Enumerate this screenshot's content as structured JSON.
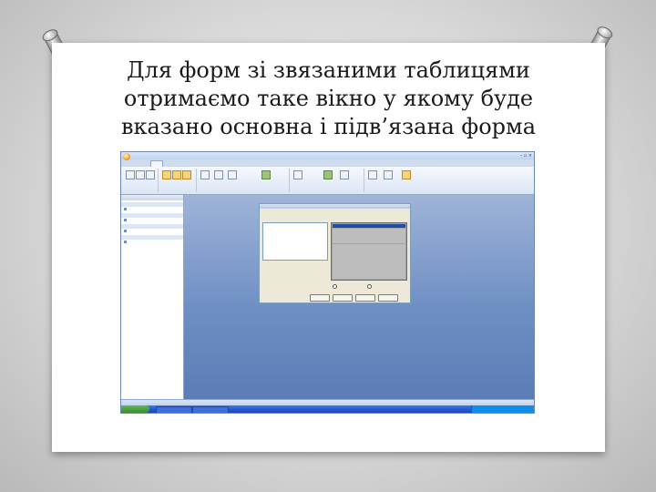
{
  "slide": {
    "title_lines": [
      "Для форм зі звязаними таблицями",
      "отримаємо таке вікно у якому буде",
      "вказано основна і підв’язана форма"
    ]
  },
  "screenshot": {
    "window_caption": "",
    "tabs": [
      "",
      "",
      "",
      ""
    ],
    "ribbon_groups": [
      "",
      "",
      "",
      ""
    ],
    "nav": {
      "header": "",
      "sections": [
        {
          "label": "",
          "items": [
            ""
          ]
        },
        {
          "label": "",
          "items": [
            ""
          ]
        },
        {
          "label": "",
          "items": [
            ""
          ]
        },
        {
          "label": "",
          "items": [
            ""
          ]
        }
      ]
    },
    "dialog": {
      "title": "",
      "question": "",
      "options": [
        "",
        ""
      ],
      "radio_1": "",
      "radio_2": "",
      "buttons": [
        "",
        "",
        "",
        ""
      ]
    },
    "status_left": "",
    "status_right": "",
    "taskbar": {
      "start_label": "",
      "buttons": [
        "",
        ""
      ],
      "clock": ""
    }
  }
}
